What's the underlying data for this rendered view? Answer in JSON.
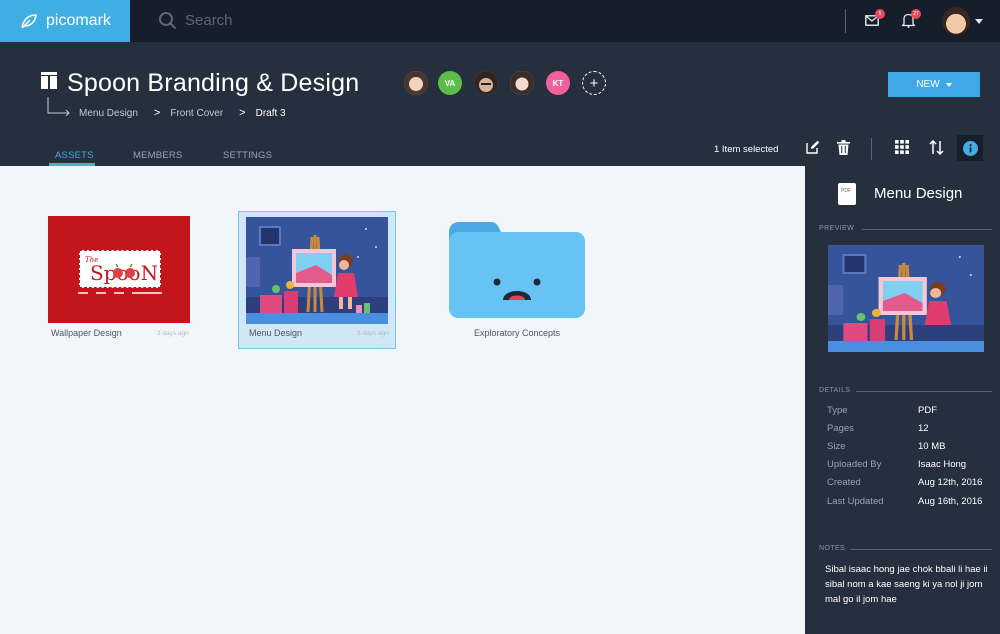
{
  "app": {
    "name": "picomark",
    "search_placeholder": "Search",
    "messages_badge": "5",
    "notifications_badge": "27",
    "brand_color": "#3eaee3",
    "icons": [
      "leaf-icon",
      "search-icon",
      "mail-icon",
      "bell-icon",
      "user-avatar",
      "chevron-down-icon"
    ]
  },
  "header": {
    "title": "Spoon Branding & Design",
    "members": [
      {
        "initials": "",
        "color": "#d9b8a6",
        "kind": "photo"
      },
      {
        "initials": "VA",
        "color": "#5bbd4a",
        "kind": "initials"
      },
      {
        "initials": "",
        "color": "#c4a08a",
        "kind": "photo"
      },
      {
        "initials": "",
        "color": "#e3cbbd",
        "kind": "photo"
      },
      {
        "initials": "KT",
        "color": "#f0609b",
        "kind": "initials"
      }
    ],
    "add_member_symbol": "+",
    "breadcrumb": [
      "Menu Design",
      "Front Cover",
      "Draft 3"
    ],
    "breadcrumb_separator": ">",
    "new_button": "NEW"
  },
  "tabs": [
    {
      "label": "ASSETS",
      "active": true
    },
    {
      "label": "MEMBERS",
      "active": false
    },
    {
      "label": "SETTINGS",
      "active": false
    }
  ],
  "toolbar": {
    "selection": "1 Item selected",
    "icons": [
      "edit-icon",
      "trash-icon",
      "grid-icon",
      "sort-icon",
      "info-icon"
    ]
  },
  "assets": [
    {
      "name": "Wallpaper Design",
      "time": "3 days ago",
      "type": "image",
      "logo_text": "The SpooN",
      "tagline": "Pizza · Pasta · Risotto · Italian Fusion Restaurant"
    },
    {
      "name": "Menu Design",
      "time": "3 days ago",
      "type": "image",
      "selected": true
    },
    {
      "name": "Exploratory Concepts",
      "type": "folder"
    }
  ],
  "panel": {
    "file_badge": "PDF",
    "title": "Menu Design",
    "preview_label": "PREVIEW",
    "details_label": "DETAILS",
    "details": [
      {
        "key": "Type",
        "value": "PDF"
      },
      {
        "key": "Pages",
        "value": "12"
      },
      {
        "key": "Size",
        "value": "10 MB"
      },
      {
        "key": "Uploaded By",
        "value": "Isaac Hong"
      },
      {
        "key": "Created",
        "value": "Aug 12th, 2016"
      },
      {
        "key": "Last Updated",
        "value": "Aug 16th, 2016"
      }
    ],
    "notes_label": "NOTES",
    "notes": "Sibal isaac hong jae chok bbali li hae ii sibal nom a kae saeng ki ya nol ji jom mal go il jom hae"
  }
}
